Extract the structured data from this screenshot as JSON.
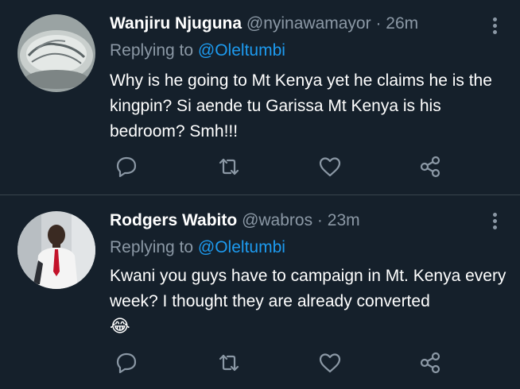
{
  "colors": {
    "background": "#15202b",
    "divider": "#38444d",
    "muted_text": "#8b98a5",
    "link": "#1d9bf0",
    "primary_text": "#ffffff"
  },
  "tweets": [
    {
      "display_name": "Wanjiru Njuguna",
      "handle": "@nyinawamayor",
      "separator": "·",
      "time": "26m",
      "reply_prefix": "Replying to",
      "reply_to": "@Oleltumbi",
      "text": "Why is he going to Mt Kenya yet he claims he is the kingpin? Si aende tu Garissa Mt Kenya is his bedroom? Smh!!!",
      "emoji": "",
      "icons": [
        "more-icon",
        "reply-icon",
        "retweet-icon",
        "like-icon",
        "share-icon"
      ]
    },
    {
      "display_name": "Rodgers Wabito",
      "handle": "@wabros",
      "separator": "·",
      "time": "23m",
      "reply_prefix": "Replying to",
      "reply_to": "@Oleltumbi",
      "text": "Kwani you guys have to campaign in Mt. Kenya every week? I thought they are already converted",
      "emoji": "😂",
      "icons": [
        "more-icon",
        "reply-icon",
        "retweet-icon",
        "like-icon",
        "share-icon"
      ]
    }
  ]
}
